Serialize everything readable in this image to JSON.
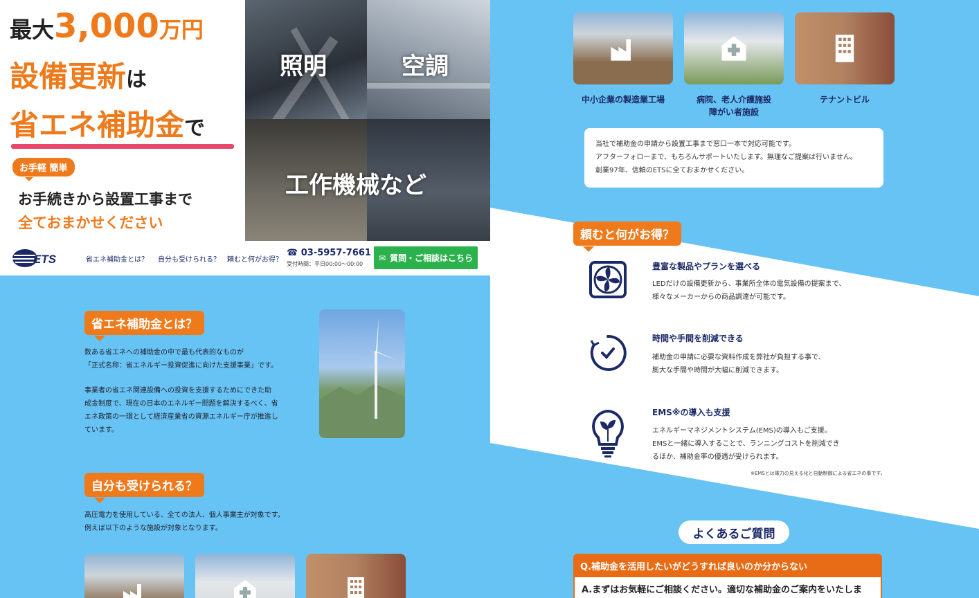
{
  "hero": {
    "line1_pre": "最大",
    "line1_amount": "3,000",
    "line1_unit": "万円",
    "line2_main": "設備更新",
    "line2_tail": "は",
    "line3_main": "省エネ補助金",
    "line3_tail": "で",
    "badge": "お手軽 簡単",
    "sub1": "お手続きから設置工事まで",
    "sub2": "全ておまかせください",
    "photos": [
      "照明",
      "空調",
      "工作機械など"
    ]
  },
  "nav": {
    "logo": "ETS",
    "links": [
      "省エネ補助金とは？",
      "自分も受けられる？",
      "頼むと何がお得？"
    ],
    "phone": "03-5957-7661",
    "hours": "受付時間：平日00:00〜00:00",
    "contact_label": "質問・ご相談はこちら"
  },
  "about": {
    "heading": "省エネ補助金とは？",
    "p1_l1": "数ある省エネへの補助金の中で最も代表的なものが",
    "p1_l2": "「正式名称：省エネルギー投資促進に向けた支援事業」です。",
    "p2_l1": "事業者の省エネ関連設備への投資を支援するためにできた助",
    "p2_l2": "成金制度で、現在の日本のエネルギー問題を解決するべく、省",
    "p2_l3": "エネ政策の一環として経済産業省の資源エネルギー庁が推進し",
    "p2_l4": "ています。"
  },
  "eligible": {
    "heading": "自分も受けられる？",
    "l1": "高圧電力を使用している、全ての法人、個人事業主が対象です。",
    "l2": "例えば以下のような施設が対象となります。"
  },
  "facilities": [
    {
      "caption": "中小企業の製造業工場",
      "icon": "factory-icon"
    },
    {
      "caption_l1": "病院、老人介護施設",
      "caption_l2": "障がい者施設",
      "icon": "hospital-icon"
    },
    {
      "caption": "テナントビル",
      "icon": "building-icon"
    }
  ],
  "info": {
    "l1": "当社で補助金の申請から設置工事まで窓口一本で対応可能です。",
    "l2": "アフターフォローまで、もちろんサポートいたします。無理なご提案は行いません。",
    "l3": "創業97年、信頼のETSに全ておまかせください。"
  },
  "benefits": {
    "heading": "頼むと何がお得？",
    "items": [
      {
        "title": "豊富な製品やプランを選べる",
        "l1": "LEDだけの設備更新から、事業所全体の電気設備の提案まで、",
        "l2": "様々なメーカーからの商品調達が可能です。",
        "icon": "fan-icon"
      },
      {
        "title": "時間や手間を削減できる",
        "l1": "補助金の申請に必要な資料作成を弊社が負担する事で、",
        "l2": "膨大な手間や時間が大幅に削減できます。",
        "icon": "clock-icon"
      },
      {
        "title": "EMS※の導入も支援",
        "l1": "エネルギーマネジメントシステム(EMS)の導入もご支援。",
        "l2": "EMSと一緒に導入することで、ランニングコストを削減でき",
        "l3": "るほか、補助金率の優遇が受けられます。",
        "icon": "lightbulb-icon"
      }
    ],
    "note": "※EMSとは電力の見える化と自動制御による省エネの事です。"
  },
  "faq": {
    "heading": "よくあるご質問",
    "q": "Q.補助金を活用したいがどうすれば良いのか分からない",
    "a": "A.まずはお気軽にご相談ください。適切な補助金のご案内をいたします。"
  },
  "colors": {
    "accent": "#ef7a1c",
    "navy": "#1b2a66",
    "sky": "#67c3f3",
    "pink": "#e8466a",
    "green": "#2bb24c"
  }
}
